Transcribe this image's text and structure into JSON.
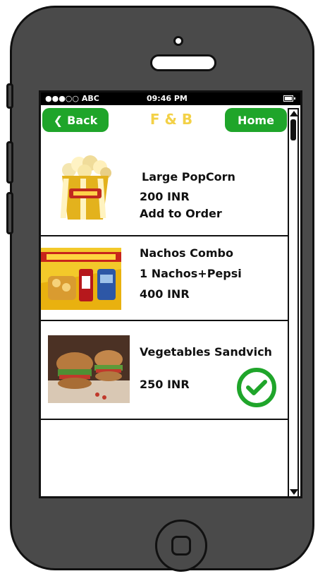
{
  "status_bar": {
    "carrier": "●●●○○ ABC",
    "time": "09:46 PM"
  },
  "nav": {
    "back_label": "Back",
    "title": "F & B",
    "home_label": "Home"
  },
  "items": [
    {
      "name": "Large PopCorn",
      "price": "200 INR",
      "action": "Add to Order"
    },
    {
      "name": "Nachos Combo",
      "description": "1 Nachos+Pepsi",
      "price": "400 INR"
    },
    {
      "name": "Vegetables Sandvich",
      "price": "250 INR",
      "selected": true
    }
  ],
  "colors": {
    "accent": "#1fa52a",
    "title": "#f3d147",
    "phone_body": "#4a4a4a"
  }
}
